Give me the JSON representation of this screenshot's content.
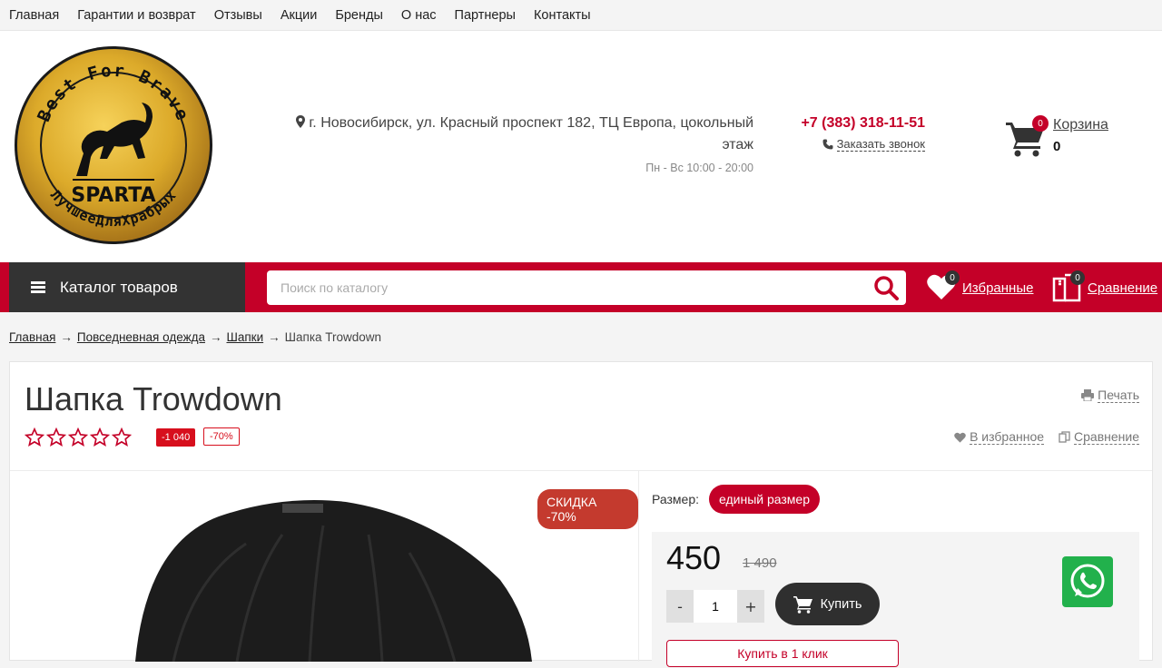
{
  "topnav": {
    "items": [
      "Главная",
      "Гарантии и возврат",
      "Отзывы",
      "Акции",
      "Бренды",
      "О нас",
      "Партнеры",
      "Контакты"
    ]
  },
  "header": {
    "logo_text_top": "Best For Brave",
    "logo_text_mid": "SPARTA",
    "logo_text_bottom": "ЛучшееДляХрабрых",
    "address_line1": "г. Новосибирск, ул. Красный проспект 182, ТЦ Европа, цокольный",
    "address_line2": "этаж",
    "hours": "Пн - Вс 10:00 - 20:00",
    "phone": "+7 (383) 318-11-51",
    "callback": "Заказать звонок",
    "cart_label": "Корзина",
    "cart_count": "0",
    "cart_total": "0"
  },
  "bar": {
    "catalog": "Каталог товаров",
    "search_placeholder": "Поиск по каталогу",
    "favorites_label": "Избранные",
    "favorites_count": "0",
    "compare_label": "Сравнение",
    "compare_count": "0"
  },
  "breadcrumbs": {
    "items": [
      "Главная",
      "Повседневная одежда",
      "Шапки"
    ],
    "current": "Шапка Trowdown",
    "arrow": "→"
  },
  "product": {
    "title": "Шапка Trowdown",
    "rating": 0,
    "save_tag": "-1 040",
    "pct_tag": "-70%",
    "print": "Печать",
    "to_favorites": "В избранное",
    "compare": "Сравнение",
    "discount_label": "СКИДКА -70%",
    "size_label": "Размер:",
    "size_value": "единый размер",
    "price": "450",
    "old_price": "1 490",
    "qty_minus": "-",
    "qty_value": "1",
    "qty_plus": "+",
    "buy": "Купить",
    "one_click": "Купить в 1 клик"
  },
  "colors": {
    "brand_red": "#c40028",
    "dark": "#333333",
    "whatsapp": "#22b14c"
  }
}
